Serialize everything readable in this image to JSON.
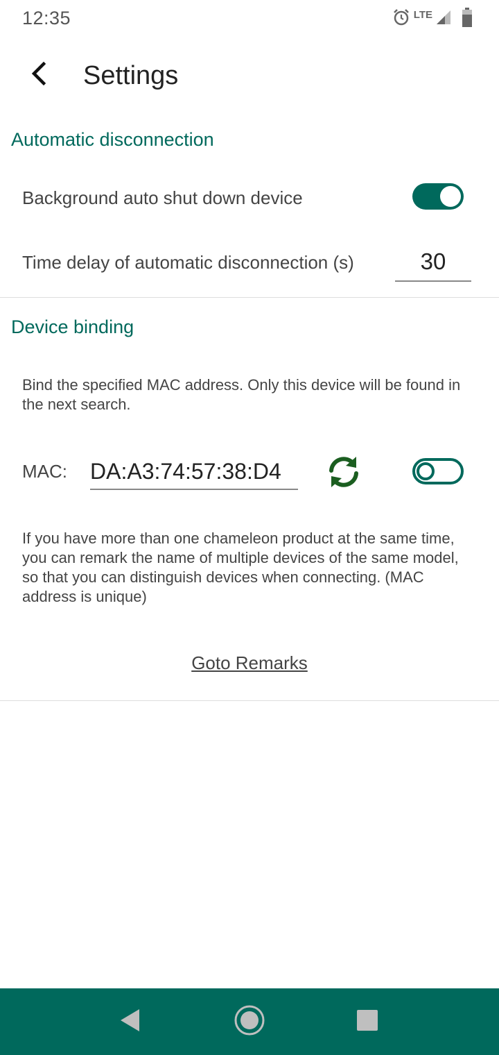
{
  "status_bar": {
    "time": "12:35",
    "network": "LTE",
    "icons": [
      "alarm-icon",
      "signal-icon",
      "battery-icon"
    ]
  },
  "app_bar": {
    "title": "Settings",
    "back_icon": "back-arrow-icon"
  },
  "auto_disconnect": {
    "header": "Automatic disconnection",
    "background_shutdown_label": "Background auto shut down device",
    "background_shutdown_enabled": true,
    "delay_label": "Time delay of automatic disconnection (s)",
    "delay_value": "30"
  },
  "device_binding": {
    "header": "Device binding",
    "description": "Bind the specified MAC address. Only this device will be found in the next search.",
    "mac_label": "MAC:",
    "mac_value": "DA:A3:74:57:38:D4",
    "refresh_icon": "refresh-icon",
    "binding_enabled": false,
    "remark_description": "If you have more than one chameleon product at the same time, you can remark the name of multiple devices of the same model, so that you can distinguish devices when connecting. (MAC address is unique)",
    "goto_remarks_label": "Goto Remarks"
  },
  "nav_bar": {
    "buttons": [
      "nav-back-icon",
      "nav-home-icon",
      "nav-recents-icon"
    ]
  },
  "colors": {
    "accent": "#00695c",
    "refresh": "#1b5e20",
    "text": "#444444",
    "title": "#222222"
  }
}
